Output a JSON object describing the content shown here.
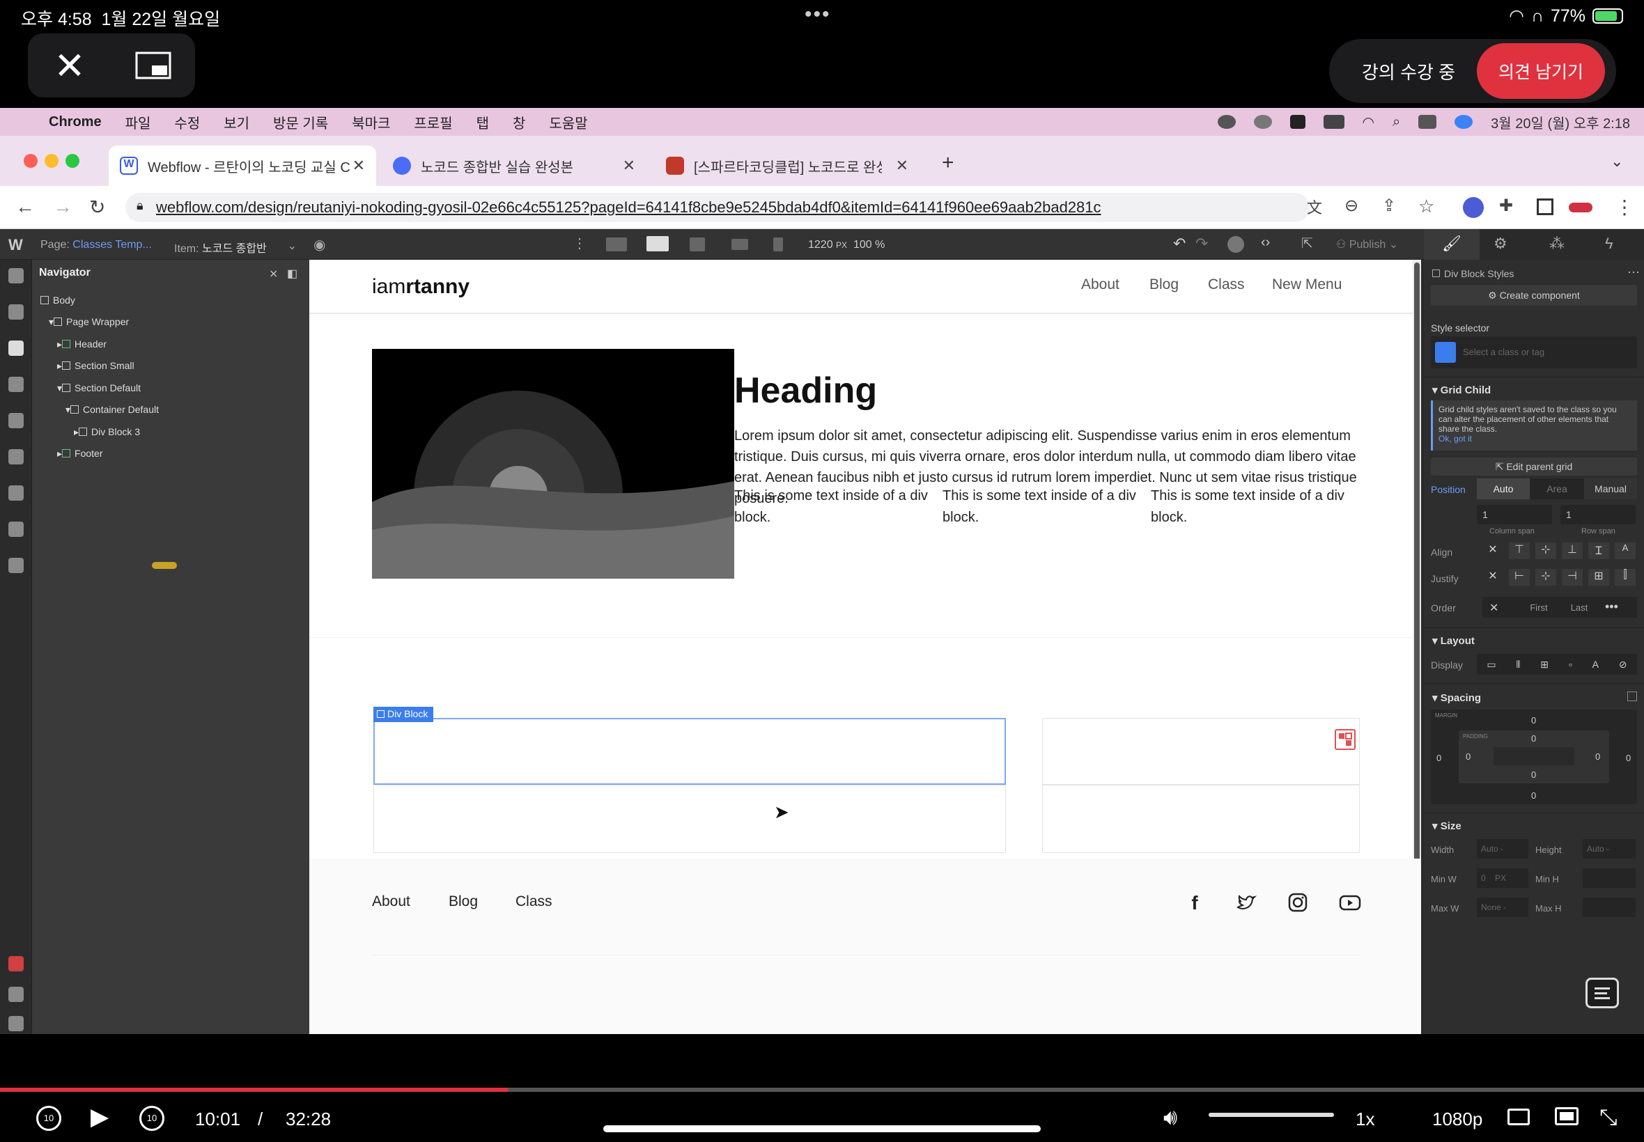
{
  "ipad_status": {
    "time": "오후 4:58",
    "date": "1월 22일 월요일",
    "battery": "77%"
  },
  "player_top": {
    "lecture_status": "강의 수강 중",
    "feedback_label": "의견 남기기"
  },
  "mac_menubar": {
    "app": "Chrome",
    "items": [
      "파일",
      "수정",
      "보기",
      "방문 기록",
      "북마크",
      "프로필",
      "탭",
      "창",
      "도움말"
    ],
    "clock": "3월 20일 (월) 오후 2:18"
  },
  "browser": {
    "tabs": [
      {
        "title": "Webflow - 르탄이의 노코딩 교실 C",
        "color": "#3b5bdb"
      },
      {
        "title": "노코드 종합반 실습 완성본",
        "color": "#4a6cf7"
      },
      {
        "title": "[스파르타코딩클럽] 노코드로 완성도",
        "color": "#c0392b"
      }
    ],
    "url": "webflow.com/design/reutaniyi-nokoding-gyosil-02e66c4c55125?pageId=64141f8cbe9e5245bdab4df0&itemId=64141f960ee69aab2bad281c"
  },
  "webflow": {
    "topbar": {
      "page_label": "Page:",
      "page_value": "Classes Temp...",
      "item_label": "Item:",
      "item_value": "노코드 종합반",
      "width": "1220",
      "width_unit": "PX",
      "zoom": "100 %",
      "publish": "Publish"
    },
    "navigator": {
      "title": "Navigator",
      "tree": [
        {
          "label": "Body",
          "depth": 0
        },
        {
          "label": "Page Wrapper",
          "depth": 1
        },
        {
          "label": "Header",
          "depth": 2
        },
        {
          "label": "Section Small",
          "depth": 2
        },
        {
          "label": "Section Default",
          "depth": 2
        },
        {
          "label": "Container Default",
          "depth": 3
        },
        {
          "label": "Div Block 3",
          "depth": 4
        },
        {
          "label": "Footer",
          "depth": 2
        }
      ]
    },
    "canvas": {
      "logo_light": "iam",
      "logo_bold": "rtanny",
      "nav": [
        "About",
        "Blog",
        "Class",
        "New Menu"
      ],
      "heading": "Heading",
      "lorem": "Lorem ipsum dolor sit amet, consectetur adipiscing elit. Suspendisse varius enim in eros elementum tristique. Duis cursus, mi quis viverra ornare, eros dolor interdum nulla, ut commodo diam libero vitae erat. Aenean faucibus nibh et justo cursus id rutrum lorem imperdiet. Nunc ut sem vitae risus tristique posuere.",
      "div_texts": [
        "This is some text inside of a div block.",
        "This is some text inside of a div block.",
        "This is some text inside of a div block."
      ],
      "selected_tag": "Div Block",
      "footer_nav": [
        "About",
        "Blog",
        "Class"
      ]
    },
    "right_panel": {
      "element_label": "Div Block Styles",
      "create_component": "Create component",
      "style_selector": "Style selector",
      "selector_placeholder": "Select a class or tag",
      "grid_child": "Grid Child",
      "grid_child_note": "Grid child styles aren't saved to the class so you can alter the placement of other elements that share the class.",
      "ok_got_it": "Ok, got it",
      "edit_parent_grid": "Edit parent grid",
      "position_label": "Position",
      "position_options": [
        "Auto",
        "Area",
        "Manual"
      ],
      "column_span_value": "1",
      "row_span_value": "1",
      "column_span": "Column span",
      "row_span": "Row span",
      "align": "Align",
      "justify": "Justify",
      "order": "Order",
      "order_options": [
        "First",
        "Last"
      ],
      "layout": "Layout",
      "display": "Display",
      "spacing": "Spacing",
      "margin_label": "MARGIN",
      "padding_label": "PADDING",
      "spacing_value": "0",
      "size": "Size",
      "width": "Width",
      "height": "Height",
      "min_w": "Min W",
      "min_h": "Min H",
      "max_w": "Max W",
      "max_h": "Max H",
      "auto": "Auto",
      "zero": "0",
      "px": "PX",
      "none": "None"
    }
  },
  "player_bottom": {
    "current_time": "10:01",
    "separator": "/",
    "duration": "32:28",
    "progress": 0.309,
    "volume": 1.0,
    "speed": "1x",
    "quality": "1080p",
    "skip_back": "10",
    "skip_forward": "10"
  },
  "colors": {
    "accent_red": "#e0313f",
    "webflow_blue": "#3b7ded"
  }
}
